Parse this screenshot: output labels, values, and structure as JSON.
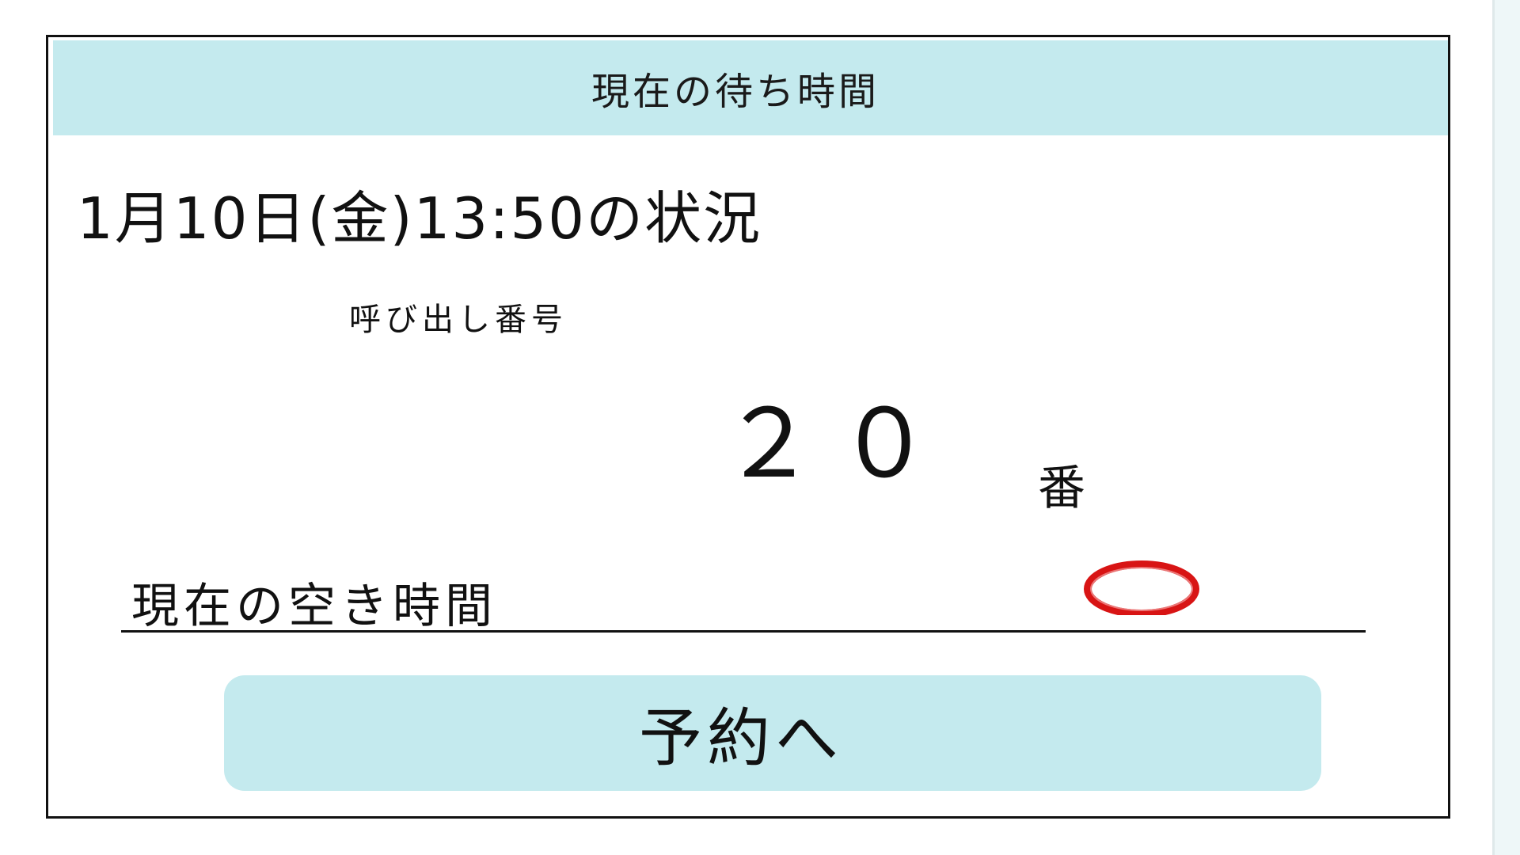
{
  "header": {
    "title": "現在の待ち時間"
  },
  "status": {
    "text": "1月10日(金)13:50の状況"
  },
  "call": {
    "label": "呼び出し番号",
    "number": "２０",
    "unit": "番"
  },
  "availability": {
    "label": "現在の空き時間",
    "mark": "circle-mark-icon",
    "mark_color": "#d81414"
  },
  "actions": {
    "reserve_label": "予約へ"
  },
  "colors": {
    "header_bg": "#c4eaee",
    "button_bg": "#c4eaee",
    "border": "#111111"
  }
}
